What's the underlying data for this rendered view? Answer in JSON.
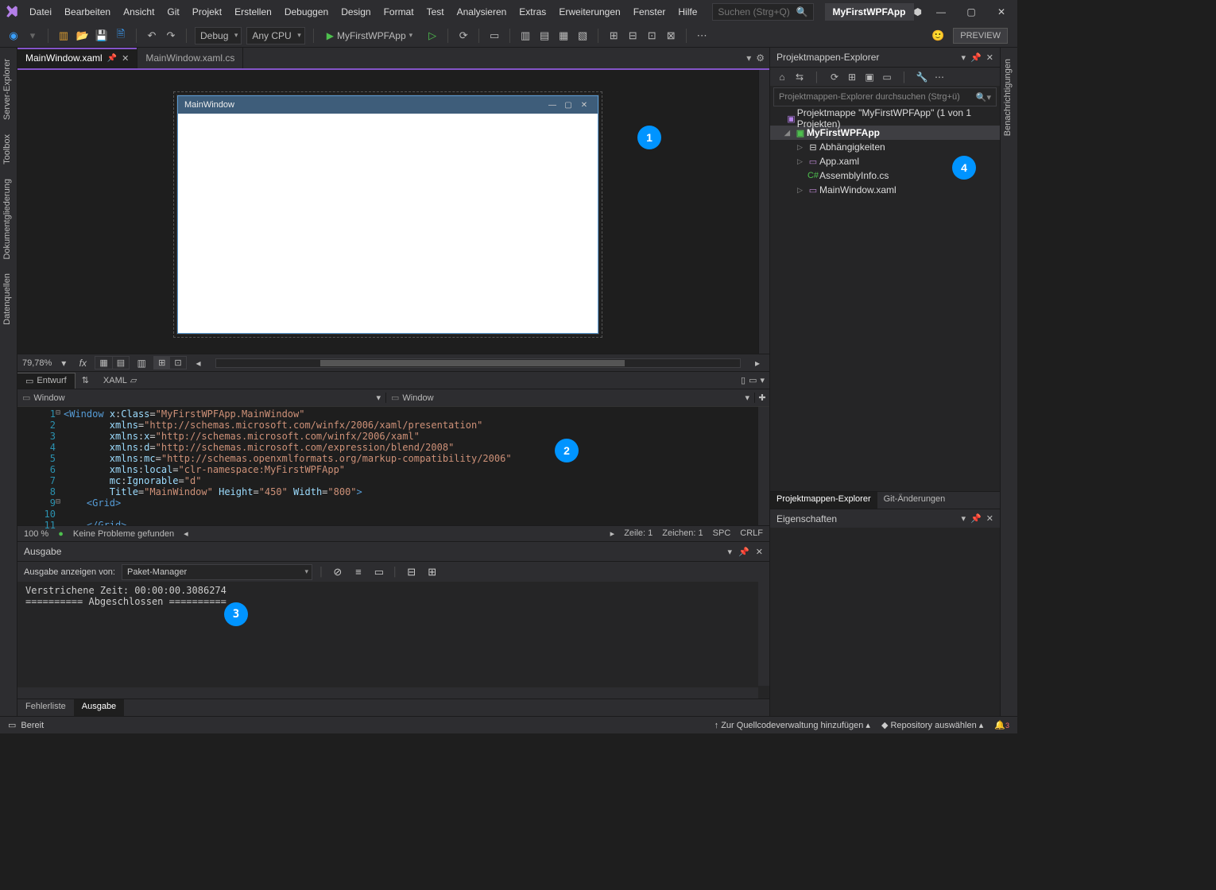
{
  "menu": [
    "Datei",
    "Bearbeiten",
    "Ansicht",
    "Git",
    "Projekt",
    "Erstellen",
    "Debuggen",
    "Design",
    "Format",
    "Test",
    "Analysieren",
    "Extras",
    "Erweiterungen",
    "Fenster",
    "Hilfe"
  ],
  "search_placeholder": "Suchen (Strg+Q)",
  "project_name": "MyFirstWPFApp",
  "preview": "PREVIEW",
  "toolbar": {
    "config": "Debug",
    "platform": "Any CPU",
    "start_target": "MyFirstWPFApp"
  },
  "left_tabs": [
    "Server-Explorer",
    "Toolbox",
    "Dokumentgliederung",
    "Datenquellen"
  ],
  "right_tab": "Benachrichtigungen",
  "doc_tabs": [
    {
      "label": "MainWindow.xaml",
      "active": true,
      "pinned": true,
      "close": true
    },
    {
      "label": "MainWindow.xaml.cs",
      "active": false
    }
  ],
  "designer": {
    "wpf_title": "MainWindow",
    "zoom": "79,78%",
    "entwurf": "Entwurf",
    "xaml": "XAML",
    "pane_left": "Window",
    "pane_right": "Window"
  },
  "code_lines": [
    {
      "n": "1",
      "collapse": "⊟",
      "html": "<span class='tag'>&lt;Window</span> <span class='attr'>x</span>:<span class='attr'>Class</span>=<span class='str'>\"MyFirstWPFApp.MainWindow\"</span>"
    },
    {
      "n": "2",
      "html": "        <span class='attr'>xmlns</span>=<span class='str'>\"http://schemas.microsoft.com/winfx/2006/xaml/presentation\"</span>"
    },
    {
      "n": "3",
      "html": "        <span class='attr'>xmlns</span>:<span class='attr'>x</span>=<span class='str'>\"http://schemas.microsoft.com/winfx/2006/xaml\"</span>"
    },
    {
      "n": "4",
      "html": "        <span class='attr'>xmlns</span>:<span class='attr'>d</span>=<span class='str'>\"http://schemas.microsoft.com/expression/blend/2008\"</span>"
    },
    {
      "n": "5",
      "html": "        <span class='attr'>xmlns</span>:<span class='attr'>mc</span>=<span class='str'>\"http://schemas.openxmlformats.org/markup-compatibility/2006\"</span>"
    },
    {
      "n": "6",
      "html": "        <span class='attr'>xmlns</span>:<span class='attr'>local</span>=<span class='str'>\"clr-namespace:MyFirstWPFApp\"</span>"
    },
    {
      "n": "7",
      "html": "        <span class='attr'>mc</span>:<span class='attr'>Ignorable</span>=<span class='str'>\"d\"</span>"
    },
    {
      "n": "8",
      "html": "        <span class='attr'>Title</span>=<span class='str'>\"MainWindow\"</span> <span class='attr'>Height</span>=<span class='str'>\"450\"</span> <span class='attr'>Width</span>=<span class='str'>\"800\"</span><span class='tag'>&gt;</span>"
    },
    {
      "n": "9",
      "collapse": "⊟",
      "html": "    <span class='tag'>&lt;Grid&gt;</span>"
    },
    {
      "n": "10",
      "html": ""
    },
    {
      "n": "11",
      "html": "    <span class='tag'>&lt;/Grid&gt;</span>"
    }
  ],
  "code_status": {
    "zoom": "100 %",
    "problems": "Keine Probleme gefunden",
    "line": "Zeile: 1",
    "col": "Zeichen: 1",
    "spc": "SPC",
    "eol": "CRLF"
  },
  "output": {
    "title": "Ausgabe",
    "from_label": "Ausgabe anzeigen von:",
    "from_value": "Paket-Manager",
    "lines": [
      "Verstrichene Zeit: 00:00:00.3086274",
      "========== Abgeschlossen =========="
    ],
    "bottom_tabs": [
      "Fehlerliste",
      "Ausgabe"
    ]
  },
  "solution": {
    "title": "Projektmappen-Explorer",
    "search_placeholder": "Projektmappen-Explorer durchsuchen (Strg+ü)",
    "root": "Projektmappe \"MyFirstWPFApp\" (1 von 1 Projekten)",
    "project": "MyFirstWPFApp",
    "items": [
      "Abhängigkeiten",
      "App.xaml",
      "AssemblyInfo.cs",
      "MainWindow.xaml"
    ],
    "bottom_tabs": [
      "Projektmappen-Explorer",
      "Git-Änderungen"
    ]
  },
  "properties": {
    "title": "Eigenschaften"
  },
  "status": {
    "ready": "Bereit",
    "scm": "Zur Quellcodeverwaltung hinzufügen",
    "repo": "Repository auswählen",
    "notif": "3"
  },
  "callouts": {
    "1": "1",
    "2": "2",
    "3": "3",
    "4": "4"
  }
}
